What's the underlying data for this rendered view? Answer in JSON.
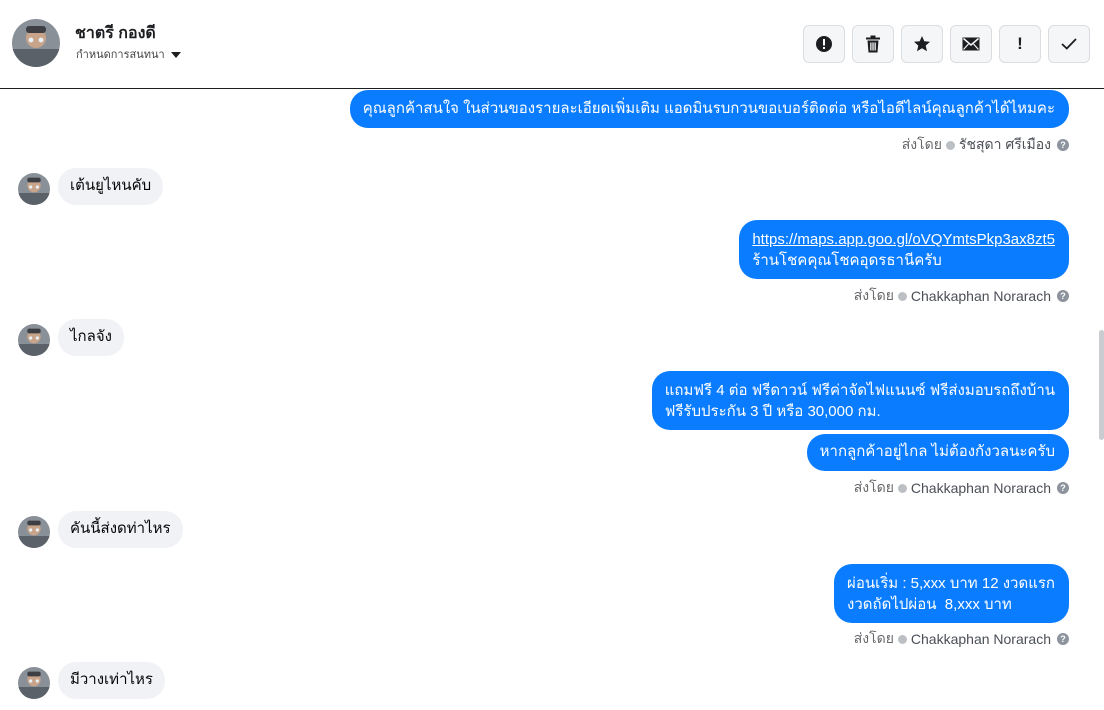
{
  "header": {
    "contact_name": "ชาตรี กองดี",
    "assign_label": "กำหนดการสนทนา",
    "toolbar": [
      {
        "name": "report-spam-button",
        "icon": "alert-circle-icon"
      },
      {
        "name": "delete-button",
        "icon": "trash-icon"
      },
      {
        "name": "star-button",
        "icon": "star-icon"
      },
      {
        "name": "mark-unread-button",
        "icon": "envelope-icon"
      },
      {
        "name": "mark-followup-button",
        "label": "!"
      },
      {
        "name": "mark-done-button",
        "icon": "check-icon"
      }
    ]
  },
  "thread": {
    "sent_by_prefix": "ส่งโดย",
    "messages": [
      {
        "direction": "out",
        "text": "คุณลูกค้าสนใจ ในส่วนของรายละเอียดเพิ่มเติม แอดมินรบกวนขอเบอร์ติดต่อ หรือไอดีไลน์คุณลูกค้าได้ไหมคะ",
        "sender": "รัชสุดา ศรีเมือง"
      },
      {
        "direction": "in",
        "text": "เต้นยูไหนคับ"
      },
      {
        "direction": "out",
        "link": "https://maps.app.goo.gl/oVQYmtsPkp3ax8zt5",
        "text": "ร้านโชคคุณโชคอุดรธานีครับ",
        "sender": "Chakkaphan Norarach"
      },
      {
        "direction": "in",
        "text": "ไกลจัง"
      },
      {
        "direction": "out",
        "line1": "แถมฟรี 4 ต่อ ฟรีดาวน์ ฟรีค่าจัดไฟแนนซ์ ฟรีส่งมอบรถถึงบ้าน",
        "line2": "ฟรีรับประกัน 3 ปี หรือ 30,000 กม."
      },
      {
        "direction": "out",
        "text": "หากลูกค้าอยู่ไกล ไม่ต้องกังวลนะครับ",
        "sender": "Chakkaphan Norarach"
      },
      {
        "direction": "in",
        "text": "คันนี้ส่งดท่าไหร"
      },
      {
        "direction": "out",
        "line1": "ผ่อนเริ่ม : 5,xxx บาท 12 งวดแรก",
        "line2": "งวดถัดไปผ่อน  8,xxx บาท",
        "sender": "Chakkaphan Norarach"
      },
      {
        "direction": "in",
        "text": "มีวางเท่าไหร"
      }
    ]
  },
  "colors": {
    "outgoing_bubble": "#0a7cff",
    "incoming_bubble": "#f0f2f5",
    "meta_text": "#65676b"
  }
}
